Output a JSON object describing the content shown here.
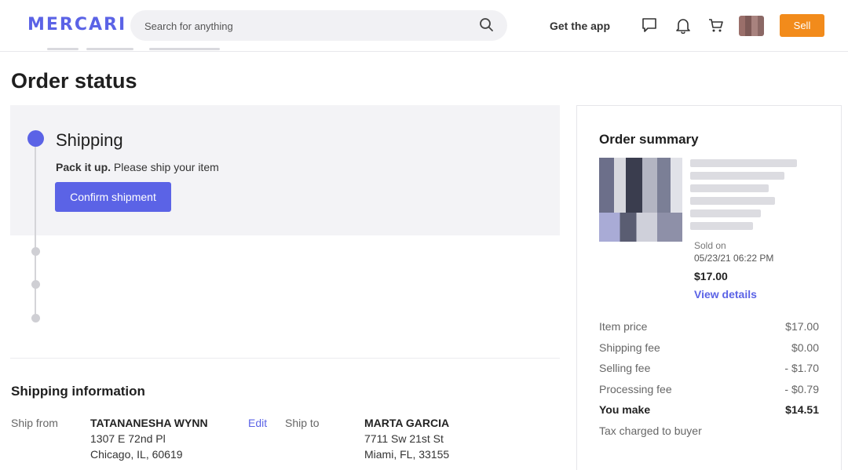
{
  "header": {
    "logo": "MERCARI",
    "search_placeholder": "Search for anything",
    "get_app": "Get the app",
    "sell": "Sell"
  },
  "page_title": "Order status",
  "status": {
    "step_title": "Shipping",
    "step_sub_bold": "Pack it up.",
    "step_sub_rest": " Please ship your item",
    "confirm_button": "Confirm shipment"
  },
  "shipping_info": {
    "title": "Shipping information",
    "ship_from_label": "Ship from",
    "from_name": "TATANANESHA WYNN",
    "from_line1": "1307 E 72nd Pl",
    "from_line2": "Chicago, IL, 60619",
    "edit": "Edit",
    "ship_to_label": "Ship to",
    "to_name": "MARTA GARCIA",
    "to_line1": "7711 Sw 21st St",
    "to_line2": "Miami, FL, 33155"
  },
  "summary": {
    "title": "Order summary",
    "sold_on_label": "Sold on",
    "sold_on_date": "05/23/21 06:22 PM",
    "price": "$17.00",
    "view_details": "View details",
    "rows": [
      {
        "label": "Item price",
        "value": "$17.00"
      },
      {
        "label": "Shipping fee",
        "value": "$0.00"
      },
      {
        "label": "Selling fee",
        "value": "- $1.70"
      },
      {
        "label": "Processing fee",
        "value": "- $0.79"
      },
      {
        "label": "You make",
        "value": "$14.51"
      },
      {
        "label": "Tax charged to buyer",
        "value": ""
      }
    ]
  },
  "colors": {
    "accent": "#5b63e6",
    "sell": "#f28b1b"
  }
}
